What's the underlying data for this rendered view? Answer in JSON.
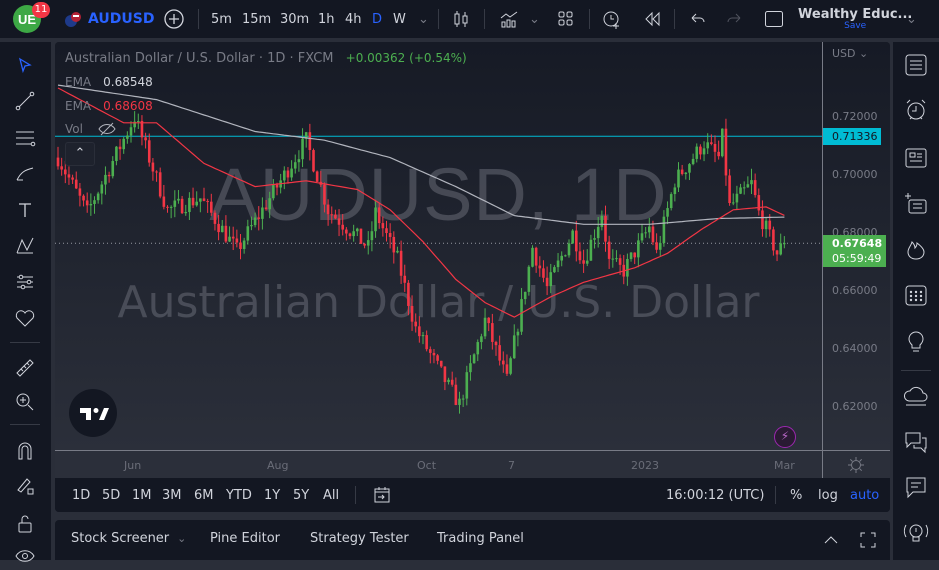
{
  "topbar": {
    "notification_count": "11",
    "symbol": "AUDUSD",
    "intervals": [
      "5m",
      "15m",
      "30m",
      "1h",
      "4h",
      "D",
      "W"
    ],
    "active_interval": "D",
    "layout_name": "Wealthy Educ...",
    "save_label": "Save"
  },
  "legend": {
    "title": "Australian Dollar / U.S. Dollar · 1D · FXCM",
    "change": "+0.00362 (+0.54%)",
    "ema1_label": "EMA",
    "ema1_value": "0.68548",
    "ema2_label": "EMA",
    "ema2_value": "0.68608",
    "vol_label": "Vol"
  },
  "watermark": {
    "line1": "AUDUSD, 1D",
    "line2": "Australian Dollar / U.S. Dollar"
  },
  "price_axis": {
    "currency": "USD",
    "ticks": [
      "0.72000",
      "0.70000",
      "0.68000",
      "0.66000",
      "0.64000",
      "0.62000"
    ],
    "horizontal_line_label": "0.71336",
    "last_price_label": "0.67648",
    "countdown": "05:59:49"
  },
  "time_axis": {
    "labels": [
      "Jun",
      "Aug",
      "Oct",
      "7",
      "2023",
      "Mar"
    ]
  },
  "range_bar": {
    "ranges": [
      "1D",
      "5D",
      "1M",
      "3M",
      "6M",
      "YTD",
      "1Y",
      "5Y",
      "All"
    ],
    "time": "16:00:12 (UTC)",
    "percent": "%",
    "log": "log",
    "auto": "auto"
  },
  "bottom_panel": {
    "tabs": [
      "Stock Screener",
      "Pine Editor",
      "Strategy Tester",
      "Trading Panel"
    ]
  },
  "colors": {
    "up": "#4caf50",
    "down": "#f23645",
    "accent": "#2962ff",
    "hline": "#00bcd4",
    "ema_fast": "#f23645",
    "ema_slow": "#b2b5be"
  },
  "chart_data": {
    "type": "candlestick",
    "title": "Australian Dollar / U.S. Dollar · 1D · FXCM",
    "ylim": [
      0.605,
      0.745
    ],
    "yticks": [
      0.72,
      0.7,
      0.68,
      0.66,
      0.64,
      0.62
    ],
    "xlabels": [
      "Jun",
      "Aug",
      "Oct",
      "7",
      "2023",
      "Mar"
    ],
    "horizontal_line": 0.71336,
    "last_price": 0.67648,
    "bar_count": 200,
    "close_path": [
      [
        0,
        0.706
      ],
      [
        8,
        0.687
      ],
      [
        21,
        0.72
      ],
      [
        30,
        0.688
      ],
      [
        39,
        0.692
      ],
      [
        49,
        0.674
      ],
      [
        68,
        0.712
      ],
      [
        74,
        0.688
      ],
      [
        85,
        0.675
      ],
      [
        87,
        0.687
      ],
      [
        93,
        0.671
      ],
      [
        98,
        0.647
      ],
      [
        107,
        0.627
      ],
      [
        110,
        0.621
      ],
      [
        117,
        0.65
      ],
      [
        123,
        0.629
      ],
      [
        129,
        0.668
      ],
      [
        130,
        0.675
      ],
      [
        134,
        0.661
      ],
      [
        141,
        0.68
      ],
      [
        144,
        0.67
      ],
      [
        149,
        0.687
      ],
      [
        151,
        0.67
      ],
      [
        155,
        0.667
      ],
      [
        162,
        0.682
      ],
      [
        164,
        0.673
      ],
      [
        169,
        0.698
      ],
      [
        177,
        0.711
      ],
      [
        181,
        0.706
      ],
      [
        182,
        0.713
      ],
      [
        184,
        0.689
      ],
      [
        190,
        0.697
      ],
      [
        192,
        0.687
      ],
      [
        197,
        0.673
      ],
      [
        199,
        0.67648
      ]
    ],
    "ema_fast": [
      [
        0,
        0.73
      ],
      [
        18,
        0.718
      ],
      [
        27,
        0.718
      ],
      [
        40,
        0.704
      ],
      [
        54,
        0.696
      ],
      [
        68,
        0.698
      ],
      [
        82,
        0.695
      ],
      [
        91,
        0.688
      ],
      [
        100,
        0.677
      ],
      [
        109,
        0.664
      ],
      [
        117,
        0.656
      ],
      [
        125,
        0.651
      ],
      [
        135,
        0.658
      ],
      [
        144,
        0.663
      ],
      [
        158,
        0.668
      ],
      [
        167,
        0.673
      ],
      [
        176,
        0.681
      ],
      [
        185,
        0.688
      ],
      [
        194,
        0.689
      ],
      [
        199,
        0.68608
      ]
    ],
    "ema_slow": [
      [
        0,
        0.731
      ],
      [
        27,
        0.726
      ],
      [
        54,
        0.715
      ],
      [
        73,
        0.712
      ],
      [
        91,
        0.706
      ],
      [
        109,
        0.696
      ],
      [
        125,
        0.686
      ],
      [
        144,
        0.683
      ],
      [
        162,
        0.683
      ],
      [
        181,
        0.685
      ],
      [
        199,
        0.68548
      ]
    ]
  }
}
